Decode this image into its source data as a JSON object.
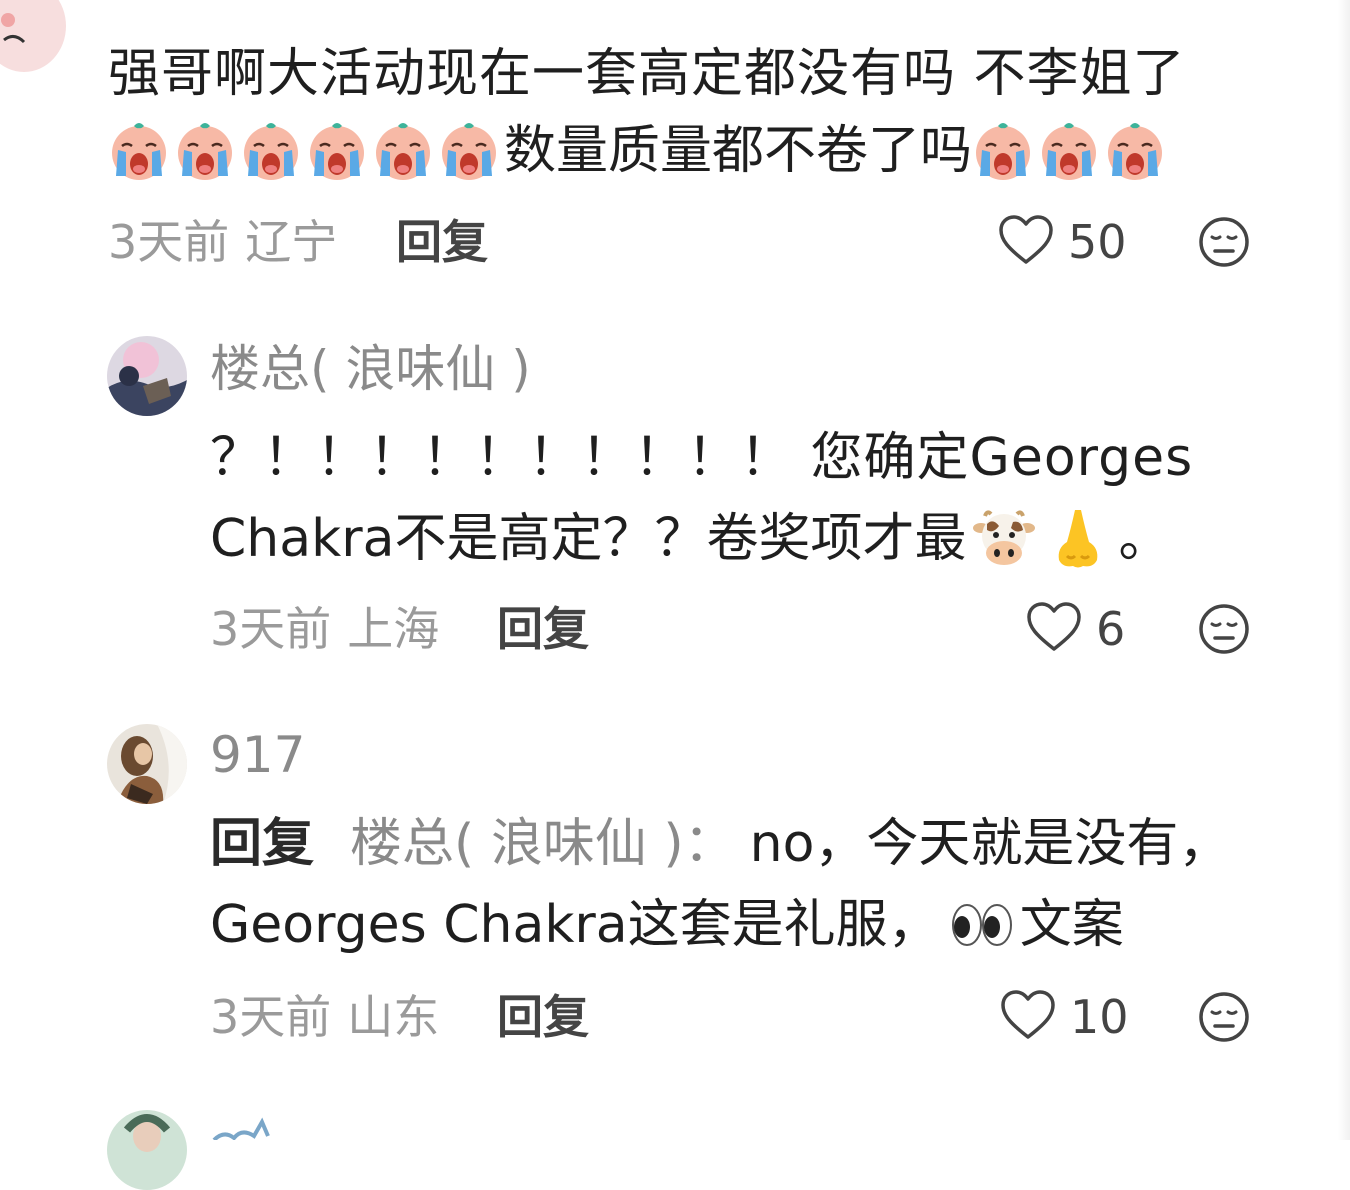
{
  "comments": [
    {
      "id": "c1",
      "line1": "强哥啊大活动现在一套高定都没有吗  不李姐了",
      "line2_text": "数量质量都不卷了吗",
      "emojis_before": [
        "crying-baby-emoji",
        "crying-baby-emoji",
        "crying-baby-emoji",
        "crying-baby-emoji",
        "crying-baby-emoji",
        "crying-baby-emoji"
      ],
      "emojis_after": [
        "crying-baby-emoji",
        "crying-baby-emoji",
        "crying-baby-emoji"
      ],
      "time": "3天前",
      "location": "辽宁",
      "reply_label": "回复",
      "likes": "50"
    },
    {
      "id": "c2",
      "username": "楼总( 浪味仙 )",
      "line1": "？！！！！！！！！！！ 您确定Georges",
      "line2_text": "Chakra不是高定？？卷奖项才最",
      "line2_emojis": [
        "cow-face-emoji",
        "nose-emoji"
      ],
      "line2_tail": "。",
      "time": "3天前",
      "location": "上海",
      "reply_label": "回复",
      "likes": "6"
    },
    {
      "id": "c3",
      "username": "917",
      "reply_prefix": "回复",
      "reply_target": "楼总( 浪味仙 )：",
      "line1_text": "no，今天就是没有，",
      "line2_text": "Georges Chakra这套是礼服，",
      "line2_emoji": "eyes-emoji",
      "line2_tail": "文案",
      "time": "3天前",
      "location": "山东",
      "reply_label": "回复",
      "likes": "10"
    }
  ],
  "colors": {
    "text": "#1f1f1f",
    "muted": "#9a9a9a",
    "icon": "#444444"
  },
  "icons": {
    "like": "heart-outline-icon",
    "dislike": "neutral-face-icon"
  }
}
